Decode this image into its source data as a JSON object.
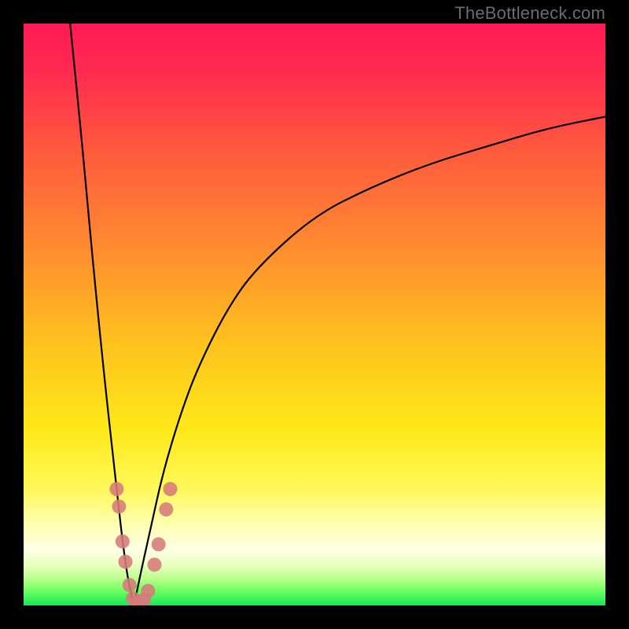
{
  "watermark": "TheBottleneck.com",
  "chart_data": {
    "type": "line",
    "title": "",
    "xlabel": "",
    "ylabel": "",
    "xlim": [
      0,
      100
    ],
    "ylim": [
      0,
      100
    ],
    "note": "Bottleneck-style V-curve. Minimum (best match) at x≈19, y≈0. Left branch steeply descends from y≈100 at x≈8 to the minimum; right branch rises asymptotically toward y≈84 at x=100.",
    "series": [
      {
        "name": "left-branch",
        "x": [
          8,
          10,
          12,
          14,
          16,
          17,
          18,
          19
        ],
        "y": [
          100,
          80,
          58,
          38,
          20,
          11,
          4,
          0
        ]
      },
      {
        "name": "right-branch",
        "x": [
          19,
          20,
          22,
          24,
          27,
          30,
          35,
          40,
          50,
          60,
          70,
          80,
          90,
          100
        ],
        "y": [
          0,
          5,
          14,
          23,
          33,
          41,
          51,
          58,
          67,
          72,
          76,
          79,
          82,
          84
        ]
      }
    ],
    "markers": {
      "name": "highlight-dots",
      "color": "#d77a7a",
      "radius_px": 9,
      "points_xy": [
        [
          16.0,
          20.0
        ],
        [
          16.4,
          17.0
        ],
        [
          17.0,
          11.0
        ],
        [
          17.5,
          7.5
        ],
        [
          18.2,
          3.5
        ],
        [
          18.8,
          1.2
        ],
        [
          19.4,
          0.4
        ],
        [
          20.0,
          0.3
        ],
        [
          20.7,
          1.0
        ],
        [
          21.4,
          2.5
        ],
        [
          22.5,
          7.0
        ],
        [
          23.2,
          10.5
        ],
        [
          24.5,
          16.5
        ],
        [
          25.2,
          20.0
        ]
      ]
    },
    "gradient_stops": [
      {
        "offset": 0.0,
        "color": "#ff1a55"
      },
      {
        "offset": 0.08,
        "color": "#ff2a50"
      },
      {
        "offset": 0.22,
        "color": "#ff5a3e"
      },
      {
        "offset": 0.38,
        "color": "#ff8a30"
      },
      {
        "offset": 0.55,
        "color": "#ffc21e"
      },
      {
        "offset": 0.7,
        "color": "#ffe91a"
      },
      {
        "offset": 0.8,
        "color": "#fff85a"
      },
      {
        "offset": 0.86,
        "color": "#ffffb0"
      },
      {
        "offset": 0.905,
        "color": "#ffffe6"
      },
      {
        "offset": 0.93,
        "color": "#eaffc0"
      },
      {
        "offset": 0.955,
        "color": "#b8ff8a"
      },
      {
        "offset": 0.975,
        "color": "#6dff60"
      },
      {
        "offset": 1.0,
        "color": "#18e858"
      }
    ]
  }
}
